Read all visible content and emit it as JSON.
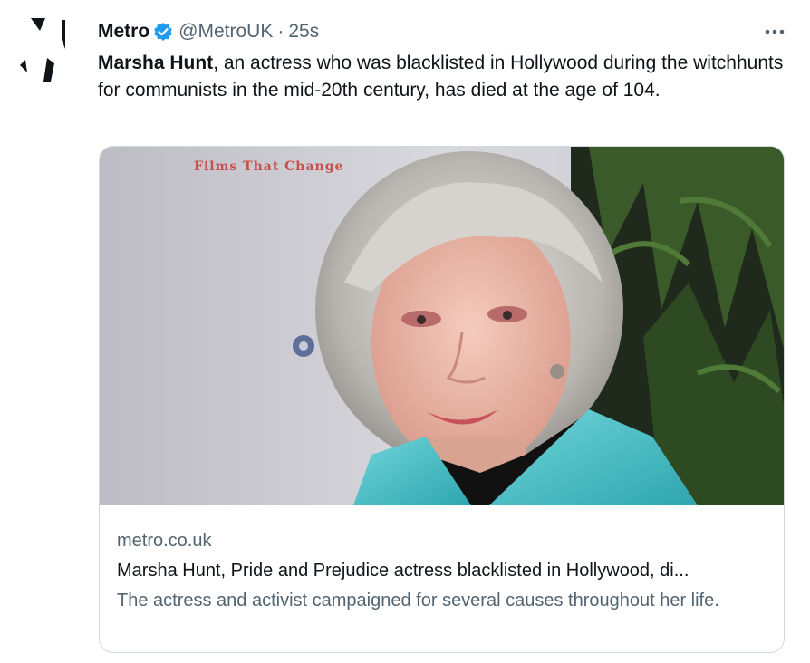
{
  "tweet": {
    "author_name": "Metro",
    "handle": "@MetroUK",
    "separator": "·",
    "timestamp": "25s",
    "verified": true,
    "text_bold": "Marsha Hunt",
    "text_rest": ", an actress who was blacklisted in Hollywood during the witchhunts for communists in the mid-20th century, has died at the age of 104."
  },
  "card": {
    "image_icon": "photo-of-woman",
    "backdrop_text": "Films That Change",
    "domain": "metro.co.uk",
    "title": "Marsha Hunt, Pride and Prejudice actress blacklisted in Hollywood, di...",
    "description": "The actress and activist campaigned for several causes throughout her life."
  },
  "icons": {
    "avatar": "metro-logo-icon",
    "verified": "verified-badge-icon",
    "more": "more-options-icon"
  },
  "colors": {
    "verified_blue": "#1d9bf0",
    "secondary_text": "#536471",
    "card_border": "#cfd9de",
    "jacket": "#4fc3c9"
  }
}
